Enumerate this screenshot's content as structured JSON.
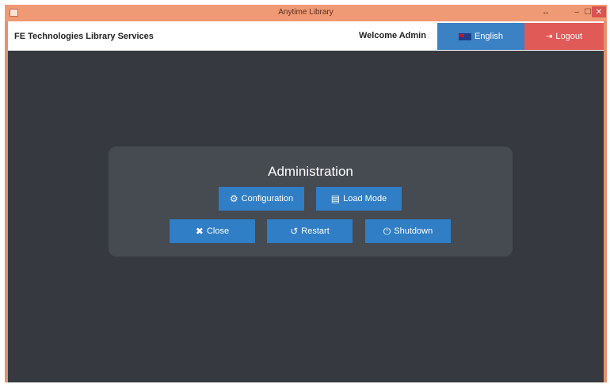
{
  "window": {
    "title": "Anytime Library",
    "controls": {
      "extra": "↔",
      "minimize": "–",
      "maximize": "☐",
      "close": "✕"
    }
  },
  "header": {
    "brand": "FE Technologies Library Services",
    "welcome": "Welcome Admin",
    "language_label": "English",
    "logout_label": "Logout"
  },
  "admin": {
    "title": "Administration",
    "buttons": {
      "configuration": "Configuration",
      "load_mode": "Load Mode",
      "close": "Close",
      "restart": "Restart",
      "shutdown": "Shutdown"
    }
  },
  "icons": {
    "configuration": "gear-icon",
    "load_mode": "book-icon",
    "close": "close-icon",
    "restart": "restart-icon",
    "shutdown": "power-icon",
    "logout": "logout-icon",
    "language": "flag-icon"
  },
  "colors": {
    "titlebar": "#ef9a74",
    "background": "#363a40",
    "panel": "#464a51",
    "primary_button": "#2f7ec6",
    "language_button": "#3b82c4",
    "logout_button": "#e05a57"
  }
}
